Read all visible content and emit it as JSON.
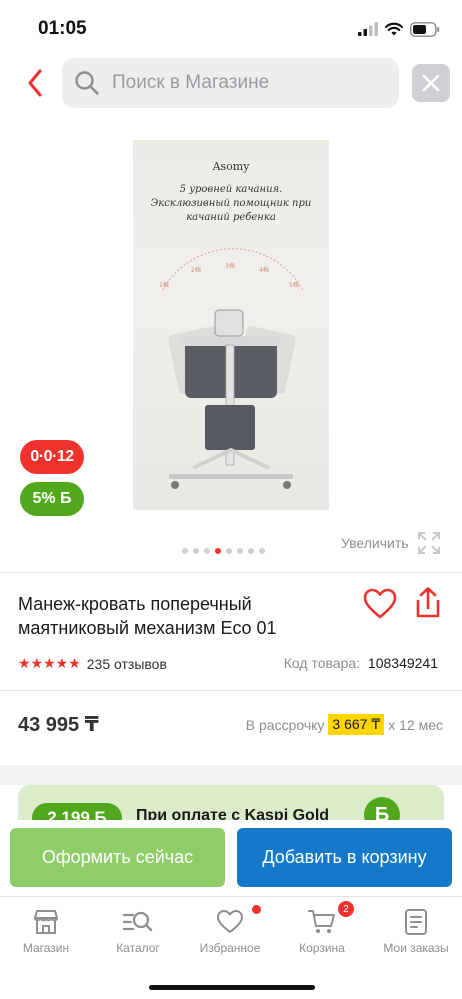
{
  "status_bar": {
    "time": "01:05"
  },
  "search": {
    "placeholder": "Поиск в Магазине"
  },
  "product": {
    "image_texts": {
      "brand": "Asomy",
      "line1": "5 уровней качания.",
      "line2": "Эксклюзивный помощник при",
      "line3": "качаний ребенка"
    },
    "badge_installment": "0·0·12",
    "badge_bonus": "5% Б",
    "gallery_total": 8,
    "gallery_active_index": 3,
    "zoom_label": "Увеличить",
    "title": "Манеж-кровать поперечный маятниковый механизм Eco 01",
    "rating_stars": 5,
    "reviews": "235 отзывов",
    "code_label": "Код товара:",
    "code_value": "108349241",
    "price": "43 995 ₸",
    "installment_prefix": "В рассрочку",
    "installment_amount": "3 667 ₸",
    "installment_suffix": "x 12 мес"
  },
  "promo": {
    "badge": "2 199 Б",
    "text": "При оплате с Kaspi Gold",
    "coin": "Б"
  },
  "actions": {
    "checkout_label": "Оформить сейчас",
    "cart_label": "Добавить в корзину"
  },
  "tabbar": {
    "items": [
      {
        "label": "Магазин"
      },
      {
        "label": "Каталог"
      },
      {
        "label": "Избранное"
      },
      {
        "label": "Корзина",
        "badge": "2"
      },
      {
        "label": "Мои заказы"
      }
    ]
  },
  "colors": {
    "accent_red": "#f0322e",
    "bonus_green": "#51a81d",
    "checkout_green": "#8fcd69",
    "cart_blue": "#1479c8",
    "installment_yellow": "#ffd600"
  }
}
